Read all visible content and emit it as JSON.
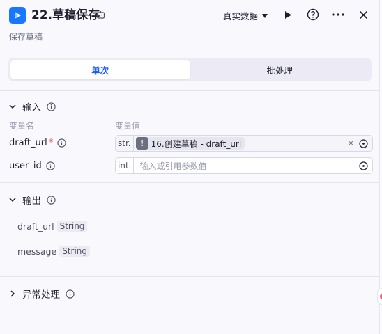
{
  "header": {
    "title": "22.草稿保存",
    "subtitle": "保存草稿",
    "data_mode": "真实数据",
    "accent": "#1677ff"
  },
  "tabs": [
    {
      "label": "单次",
      "active": true
    },
    {
      "label": "批处理",
      "active": false
    }
  ],
  "input_section": {
    "title": "输入",
    "col_name": "变量名",
    "col_value": "变量值",
    "params": [
      {
        "name": "draft_url",
        "required_mark": "*",
        "type": "str.",
        "ref_badge": "!",
        "ref_text": "16.创建草稿 - draft_url",
        "clear": "×"
      },
      {
        "name": "user_id",
        "type": "int.",
        "placeholder": "输入或引用参数值"
      }
    ]
  },
  "output_section": {
    "title": "输出",
    "items": [
      {
        "name": "draft_url",
        "type": "String"
      },
      {
        "name": "message",
        "type": "String"
      }
    ]
  },
  "error_section": {
    "title": "异常处理"
  }
}
